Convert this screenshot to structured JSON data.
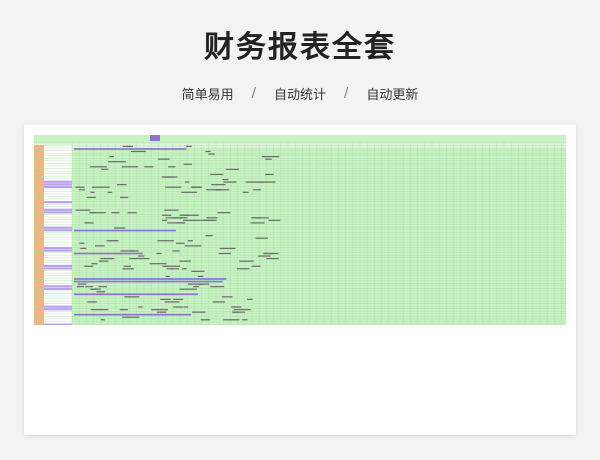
{
  "page": {
    "title": "财务报表全套",
    "features": [
      "简单易用",
      "自动统计",
      "自动更新"
    ],
    "separator": "/"
  },
  "sheet": {
    "colors": {
      "grid_fill": "#c8f2c4",
      "grid_line": "#a9dda3",
      "label_col": "#ffffff",
      "orange_col": "#f1b37a",
      "header_row": "#dff5dd",
      "purple": "#8d6fd6",
      "violet": "#b7a1ec",
      "text_mark": "#6b6b6b"
    },
    "accent_rows": [
      14,
      15,
      16,
      22,
      25,
      26,
      32,
      33,
      40,
      41,
      47,
      48,
      55,
      56,
      63,
      64,
      70,
      71
    ]
  }
}
